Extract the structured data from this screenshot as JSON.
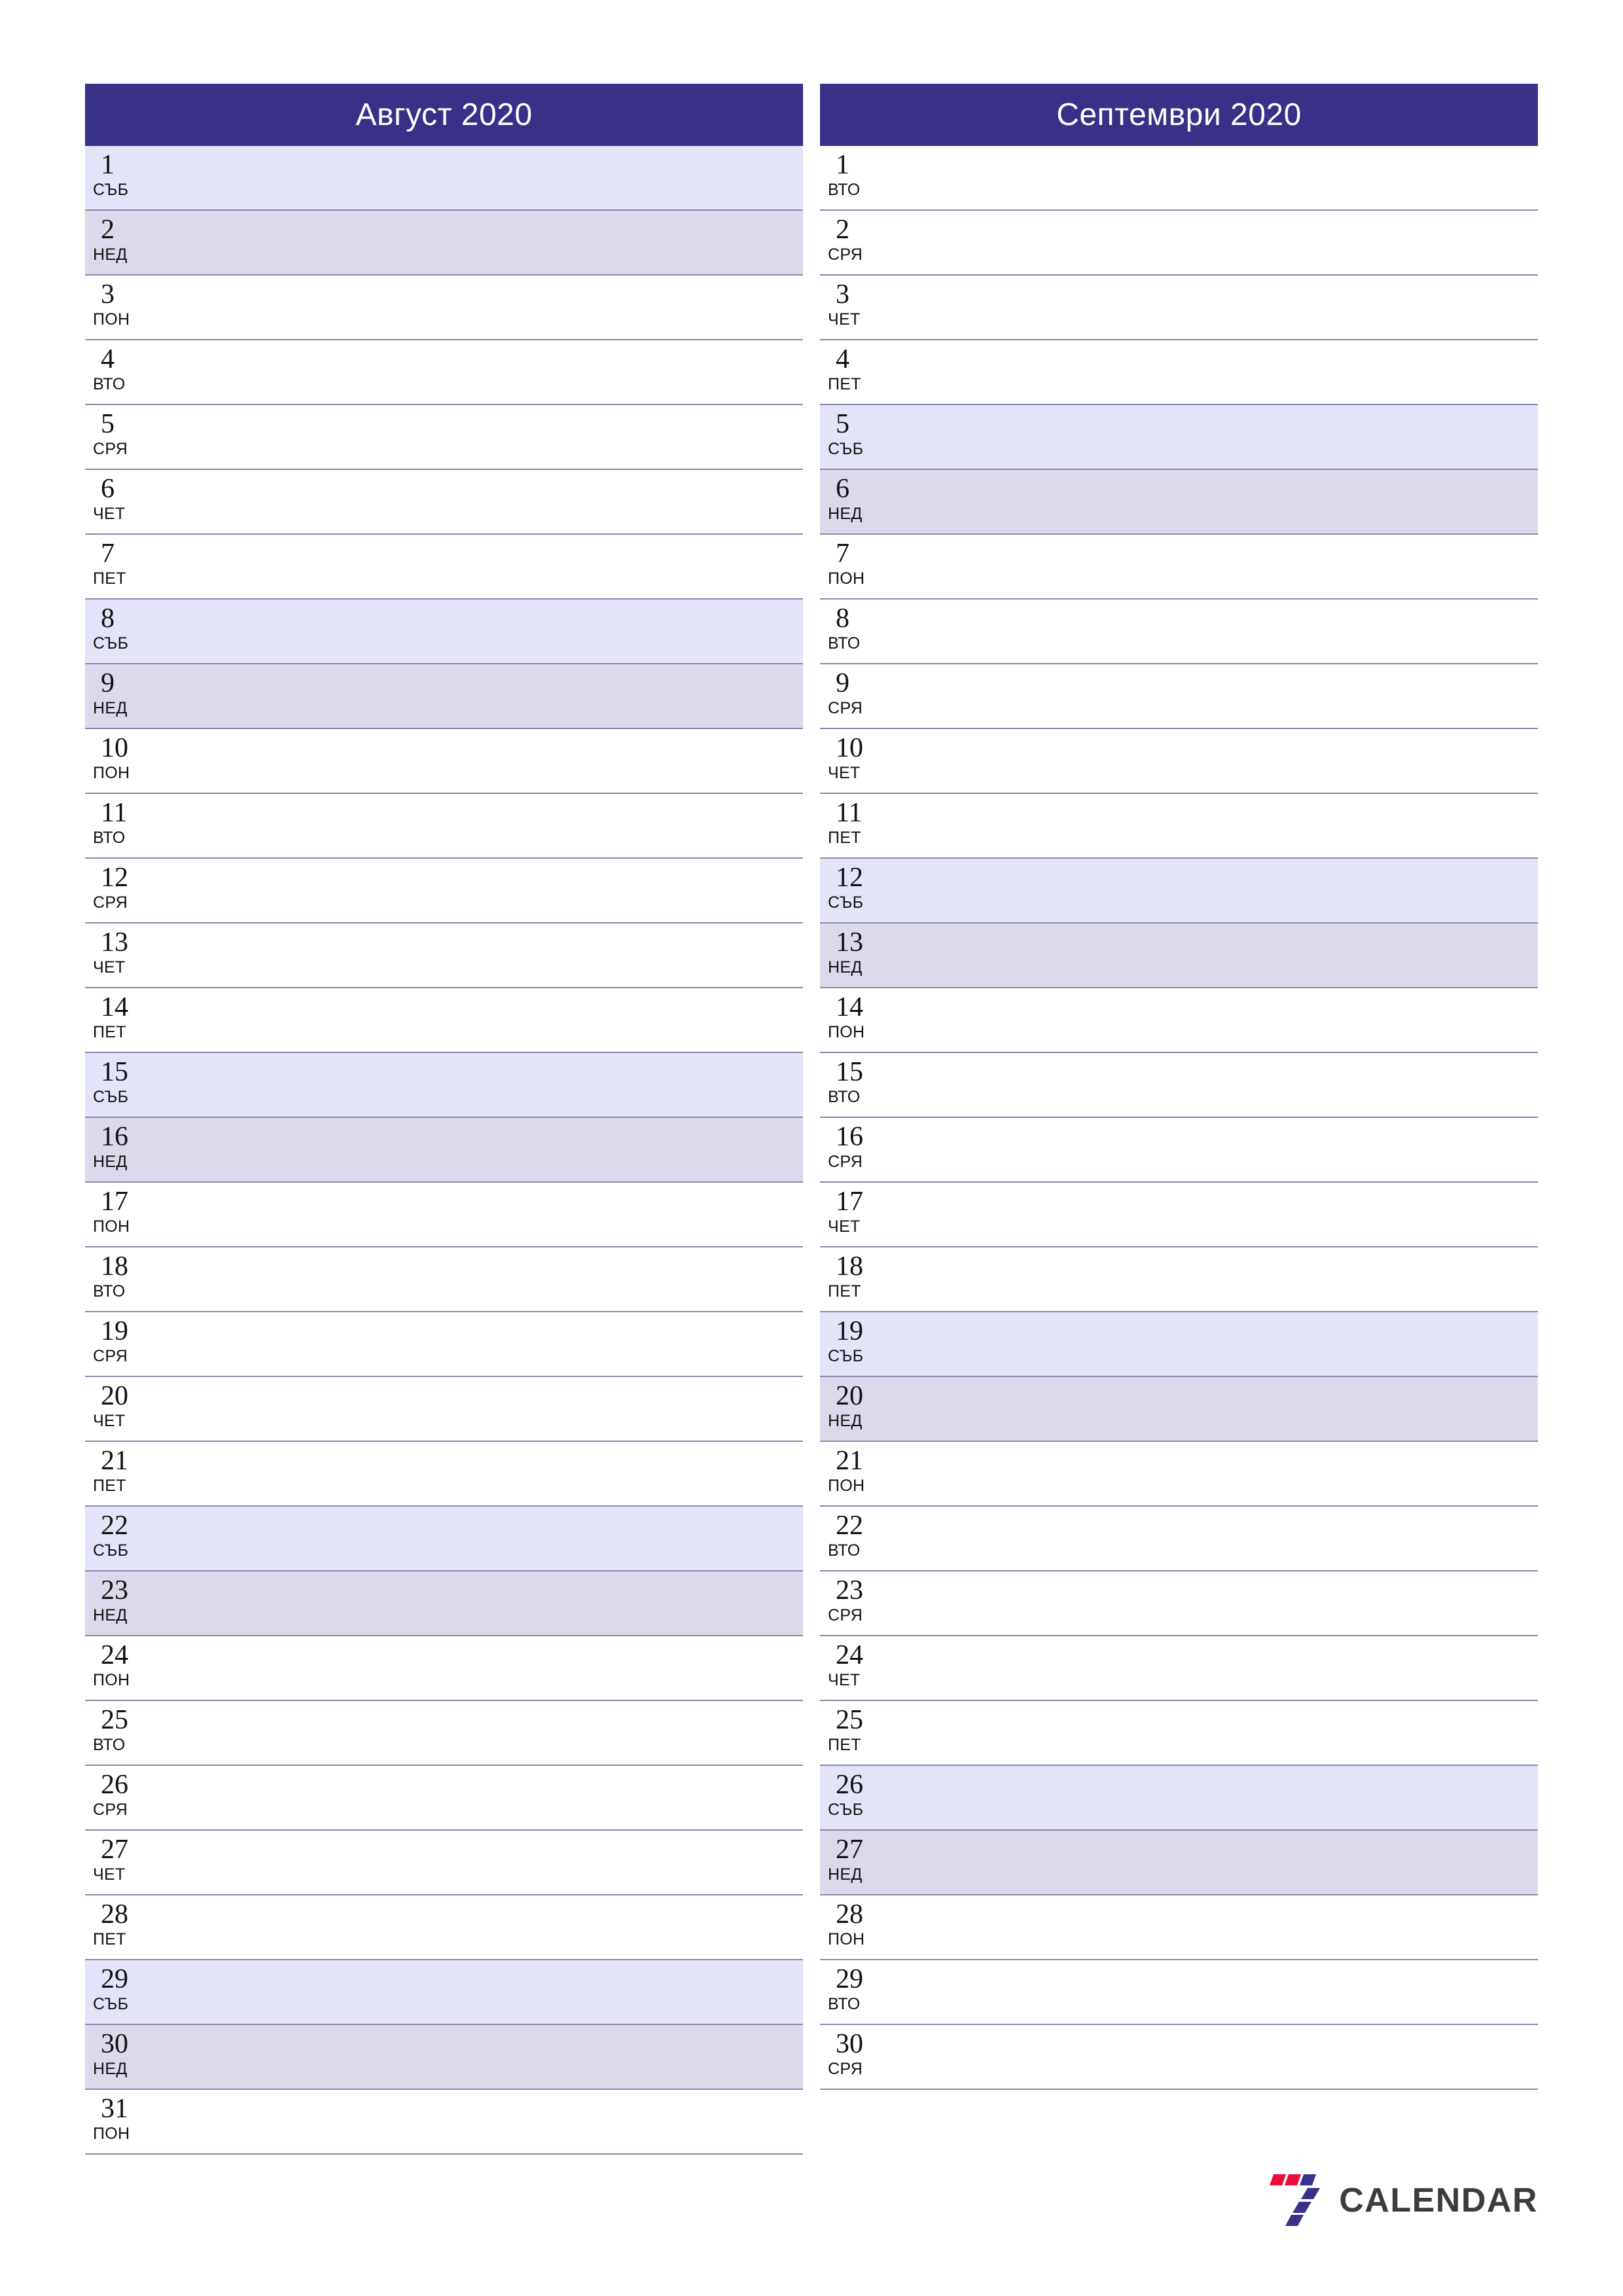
{
  "document": {
    "type": "monthly-planner",
    "language": "bg",
    "orientation": "portrait"
  },
  "colors": {
    "header_bg": "#393087",
    "header_text": "#ffffff",
    "saturday_bg": "#e3e4f8",
    "sunday_bg": "#dcd9ea",
    "grid_line": "#8b87ae",
    "day_text": "#111111",
    "logo_red": "#ed0b3c",
    "logo_navy": "#3a3189",
    "logo_word": "#3c3c3c"
  },
  "months": [
    {
      "title": "Август 2020",
      "name": "Август",
      "year": "2020",
      "days": [
        {
          "num": "1",
          "weekday": "СЪБ",
          "kind": "sat"
        },
        {
          "num": "2",
          "weekday": "НЕД",
          "kind": "sun"
        },
        {
          "num": "3",
          "weekday": "ПОН",
          "kind": "weekday"
        },
        {
          "num": "4",
          "weekday": "ВТО",
          "kind": "weekday"
        },
        {
          "num": "5",
          "weekday": "СРЯ",
          "kind": "weekday"
        },
        {
          "num": "6",
          "weekday": "ЧЕТ",
          "kind": "weekday"
        },
        {
          "num": "7",
          "weekday": "ПЕТ",
          "kind": "weekday"
        },
        {
          "num": "8",
          "weekday": "СЪБ",
          "kind": "sat"
        },
        {
          "num": "9",
          "weekday": "НЕД",
          "kind": "sun"
        },
        {
          "num": "10",
          "weekday": "ПОН",
          "kind": "weekday"
        },
        {
          "num": "11",
          "weekday": "ВТО",
          "kind": "weekday"
        },
        {
          "num": "12",
          "weekday": "СРЯ",
          "kind": "weekday"
        },
        {
          "num": "13",
          "weekday": "ЧЕТ",
          "kind": "weekday"
        },
        {
          "num": "14",
          "weekday": "ПЕТ",
          "kind": "weekday"
        },
        {
          "num": "15",
          "weekday": "СЪБ",
          "kind": "sat"
        },
        {
          "num": "16",
          "weekday": "НЕД",
          "kind": "sun"
        },
        {
          "num": "17",
          "weekday": "ПОН",
          "kind": "weekday"
        },
        {
          "num": "18",
          "weekday": "ВТО",
          "kind": "weekday"
        },
        {
          "num": "19",
          "weekday": "СРЯ",
          "kind": "weekday"
        },
        {
          "num": "20",
          "weekday": "ЧЕТ",
          "kind": "weekday"
        },
        {
          "num": "21",
          "weekday": "ПЕТ",
          "kind": "weekday"
        },
        {
          "num": "22",
          "weekday": "СЪБ",
          "kind": "sat"
        },
        {
          "num": "23",
          "weekday": "НЕД",
          "kind": "sun"
        },
        {
          "num": "24",
          "weekday": "ПОН",
          "kind": "weekday"
        },
        {
          "num": "25",
          "weekday": "ВТО",
          "kind": "weekday"
        },
        {
          "num": "26",
          "weekday": "СРЯ",
          "kind": "weekday"
        },
        {
          "num": "27",
          "weekday": "ЧЕТ",
          "kind": "weekday"
        },
        {
          "num": "28",
          "weekday": "ПЕТ",
          "kind": "weekday"
        },
        {
          "num": "29",
          "weekday": "СЪБ",
          "kind": "sat"
        },
        {
          "num": "30",
          "weekday": "НЕД",
          "kind": "sun"
        },
        {
          "num": "31",
          "weekday": "ПОН",
          "kind": "weekday"
        }
      ]
    },
    {
      "title": "Септември 2020",
      "name": "Септември",
      "year": "2020",
      "days": [
        {
          "num": "1",
          "weekday": "ВТО",
          "kind": "weekday"
        },
        {
          "num": "2",
          "weekday": "СРЯ",
          "kind": "weekday"
        },
        {
          "num": "3",
          "weekday": "ЧЕТ",
          "kind": "weekday"
        },
        {
          "num": "4",
          "weekday": "ПЕТ",
          "kind": "weekday"
        },
        {
          "num": "5",
          "weekday": "СЪБ",
          "kind": "sat"
        },
        {
          "num": "6",
          "weekday": "НЕД",
          "kind": "sun"
        },
        {
          "num": "7",
          "weekday": "ПОН",
          "kind": "weekday"
        },
        {
          "num": "8",
          "weekday": "ВТО",
          "kind": "weekday"
        },
        {
          "num": "9",
          "weekday": "СРЯ",
          "kind": "weekday"
        },
        {
          "num": "10",
          "weekday": "ЧЕТ",
          "kind": "weekday"
        },
        {
          "num": "11",
          "weekday": "ПЕТ",
          "kind": "weekday"
        },
        {
          "num": "12",
          "weekday": "СЪБ",
          "kind": "sat"
        },
        {
          "num": "13",
          "weekday": "НЕД",
          "kind": "sun"
        },
        {
          "num": "14",
          "weekday": "ПОН",
          "kind": "weekday"
        },
        {
          "num": "15",
          "weekday": "ВТО",
          "kind": "weekday"
        },
        {
          "num": "16",
          "weekday": "СРЯ",
          "kind": "weekday"
        },
        {
          "num": "17",
          "weekday": "ЧЕТ",
          "kind": "weekday"
        },
        {
          "num": "18",
          "weekday": "ПЕТ",
          "kind": "weekday"
        },
        {
          "num": "19",
          "weekday": "СЪБ",
          "kind": "sat"
        },
        {
          "num": "20",
          "weekday": "НЕД",
          "kind": "sun"
        },
        {
          "num": "21",
          "weekday": "ПОН",
          "kind": "weekday"
        },
        {
          "num": "22",
          "weekday": "ВТО",
          "kind": "weekday"
        },
        {
          "num": "23",
          "weekday": "СРЯ",
          "kind": "weekday"
        },
        {
          "num": "24",
          "weekday": "ЧЕТ",
          "kind": "weekday"
        },
        {
          "num": "25",
          "weekday": "ПЕТ",
          "kind": "weekday"
        },
        {
          "num": "26",
          "weekday": "СЪБ",
          "kind": "sat"
        },
        {
          "num": "27",
          "weekday": "НЕД",
          "kind": "sun"
        },
        {
          "num": "28",
          "weekday": "ПОН",
          "kind": "weekday"
        },
        {
          "num": "29",
          "weekday": "ВТО",
          "kind": "weekday"
        },
        {
          "num": "30",
          "weekday": "СРЯ",
          "kind": "weekday"
        }
      ]
    }
  ],
  "brand": {
    "word": "CALENDAR",
    "mark": "seven-logo-icon"
  }
}
